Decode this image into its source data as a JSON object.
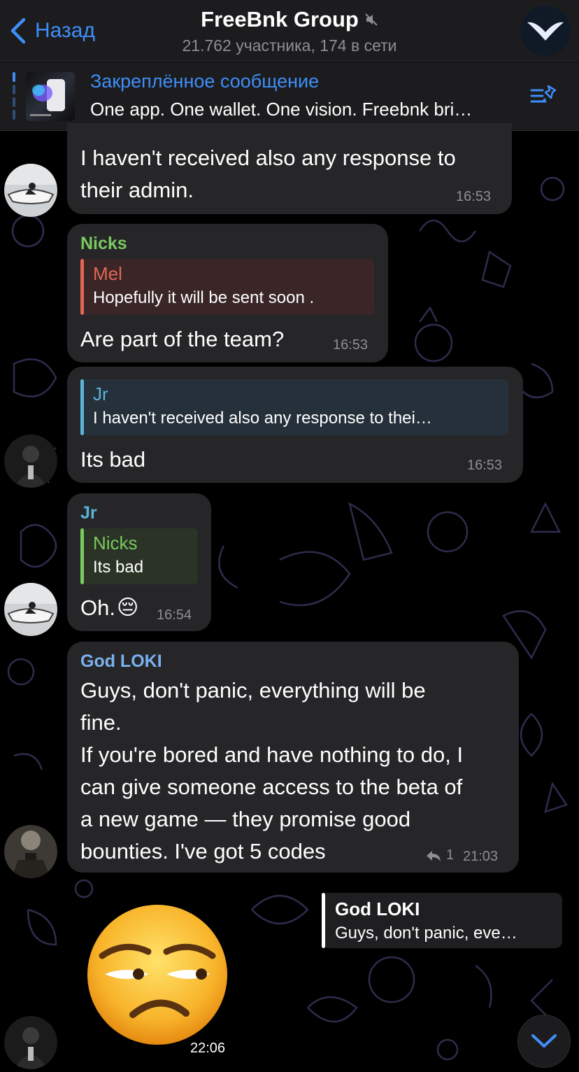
{
  "header": {
    "back_label": "Назад",
    "title": "FreeBnk Group",
    "subtitle": "21.762 участника, 174 в сети"
  },
  "pinned": {
    "title": "Закреплённое сообщение",
    "text": "One app. One wallet. One vision. Freebnk bri…"
  },
  "messages": [
    {
      "text_lines": [
        "I haven't received also any response to",
        "their admin."
      ],
      "time": "16:53"
    },
    {
      "sender": "Nicks",
      "reply": {
        "name": "Mel",
        "text": "Hopefully it will be sent soon ."
      },
      "text": "Are part of the team?",
      "time": "16:53"
    },
    {
      "reply": {
        "name": "Jr",
        "text": "I haven't received also any response to thei…"
      },
      "text": "Its bad",
      "time": "16:53"
    },
    {
      "sender": "Jr",
      "reply": {
        "name": "Nicks",
        "text": "Its bad"
      },
      "text": "Oh.",
      "emoji": "😔",
      "time": "16:54"
    },
    {
      "sender": "God LOKI",
      "text_lines": [
        "Guys, don't panic, everything will be",
        "fine.",
        "If you're bored and have nothing to do, I",
        "can give someone access to the beta of",
        "a new game — they promise good",
        "bounties. I've got 5 codes"
      ],
      "reply_count": "1",
      "time": "21:03"
    },
    {
      "reply": {
        "name": "God LOKI",
        "text": "Guys, don't panic, eve…"
      },
      "emoji_icon": "unamused-face",
      "time": "22:06"
    }
  ],
  "colors": {
    "accent": "#3e8ef7",
    "nicks": "#7ac95f",
    "mel": "#e16654",
    "jr": "#5ab3d6",
    "loki": "#7ab1ee"
  }
}
